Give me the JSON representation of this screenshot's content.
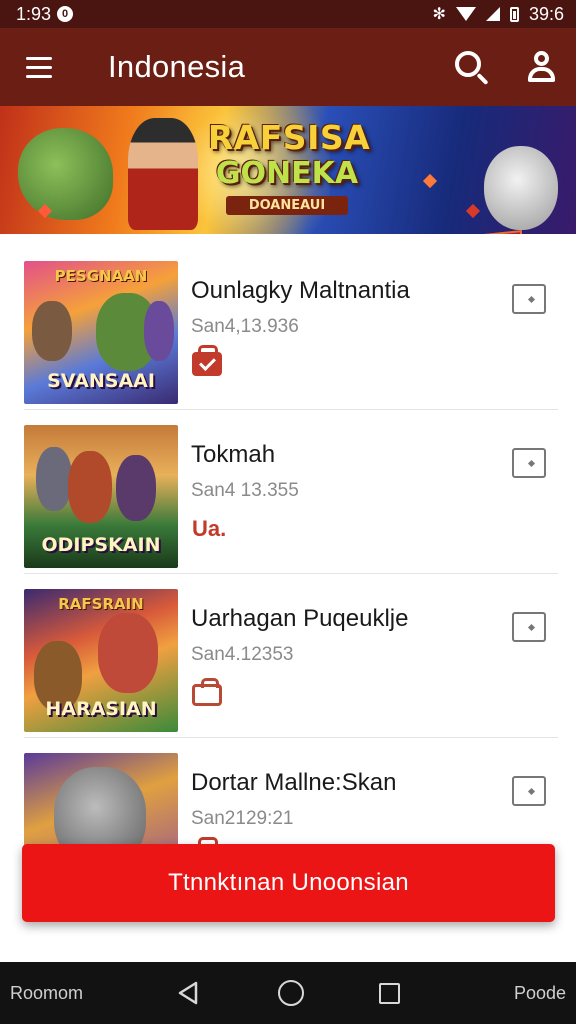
{
  "status_bar": {
    "time": "1:93",
    "notification_badge": "0",
    "battery_text": "39:6"
  },
  "app_bar": {
    "title": "Indonesia",
    "icons": [
      "menu-icon",
      "search-icon",
      "user-icon"
    ]
  },
  "banner": {
    "title_line1": "RAFSISA",
    "title_line2": "GONEKA",
    "title_line3": "DOANEAUI"
  },
  "items": [
    {
      "thumb_title": "PESGNAAN",
      "thumb_bottom": "SVANSAAI",
      "title": "Ounlagky Maltnantia",
      "subtitle": "San4,13.936",
      "badge": "check",
      "badge_text": ""
    },
    {
      "thumb_title": "",
      "thumb_bottom": "ODIPSKAIN",
      "title": "Tokmah",
      "subtitle": "San4 13.355",
      "badge": "text",
      "badge_text": "Ua."
    },
    {
      "thumb_title": "RAFSRAIN",
      "thumb_bottom": "HARASIAN",
      "title": "Uarhagan Puqeuklje",
      "subtitle": "San4.12353",
      "badge": "outline",
      "badge_text": ""
    },
    {
      "thumb_title": "",
      "thumb_bottom": "",
      "title": "Dortar Mallne:Skan",
      "subtitle": "San2129:21",
      "badge": "check",
      "badge_text": ""
    }
  ],
  "cta": {
    "label": "Ttnnktınan Unoonsian"
  },
  "nav_bar": {
    "left_label": "Roomom",
    "right_label": "Poode"
  },
  "colors": {
    "status_bar": "#4a1510",
    "app_bar": "#6b1f14",
    "cta": "#ec1515",
    "badge": "#c23a2c"
  }
}
